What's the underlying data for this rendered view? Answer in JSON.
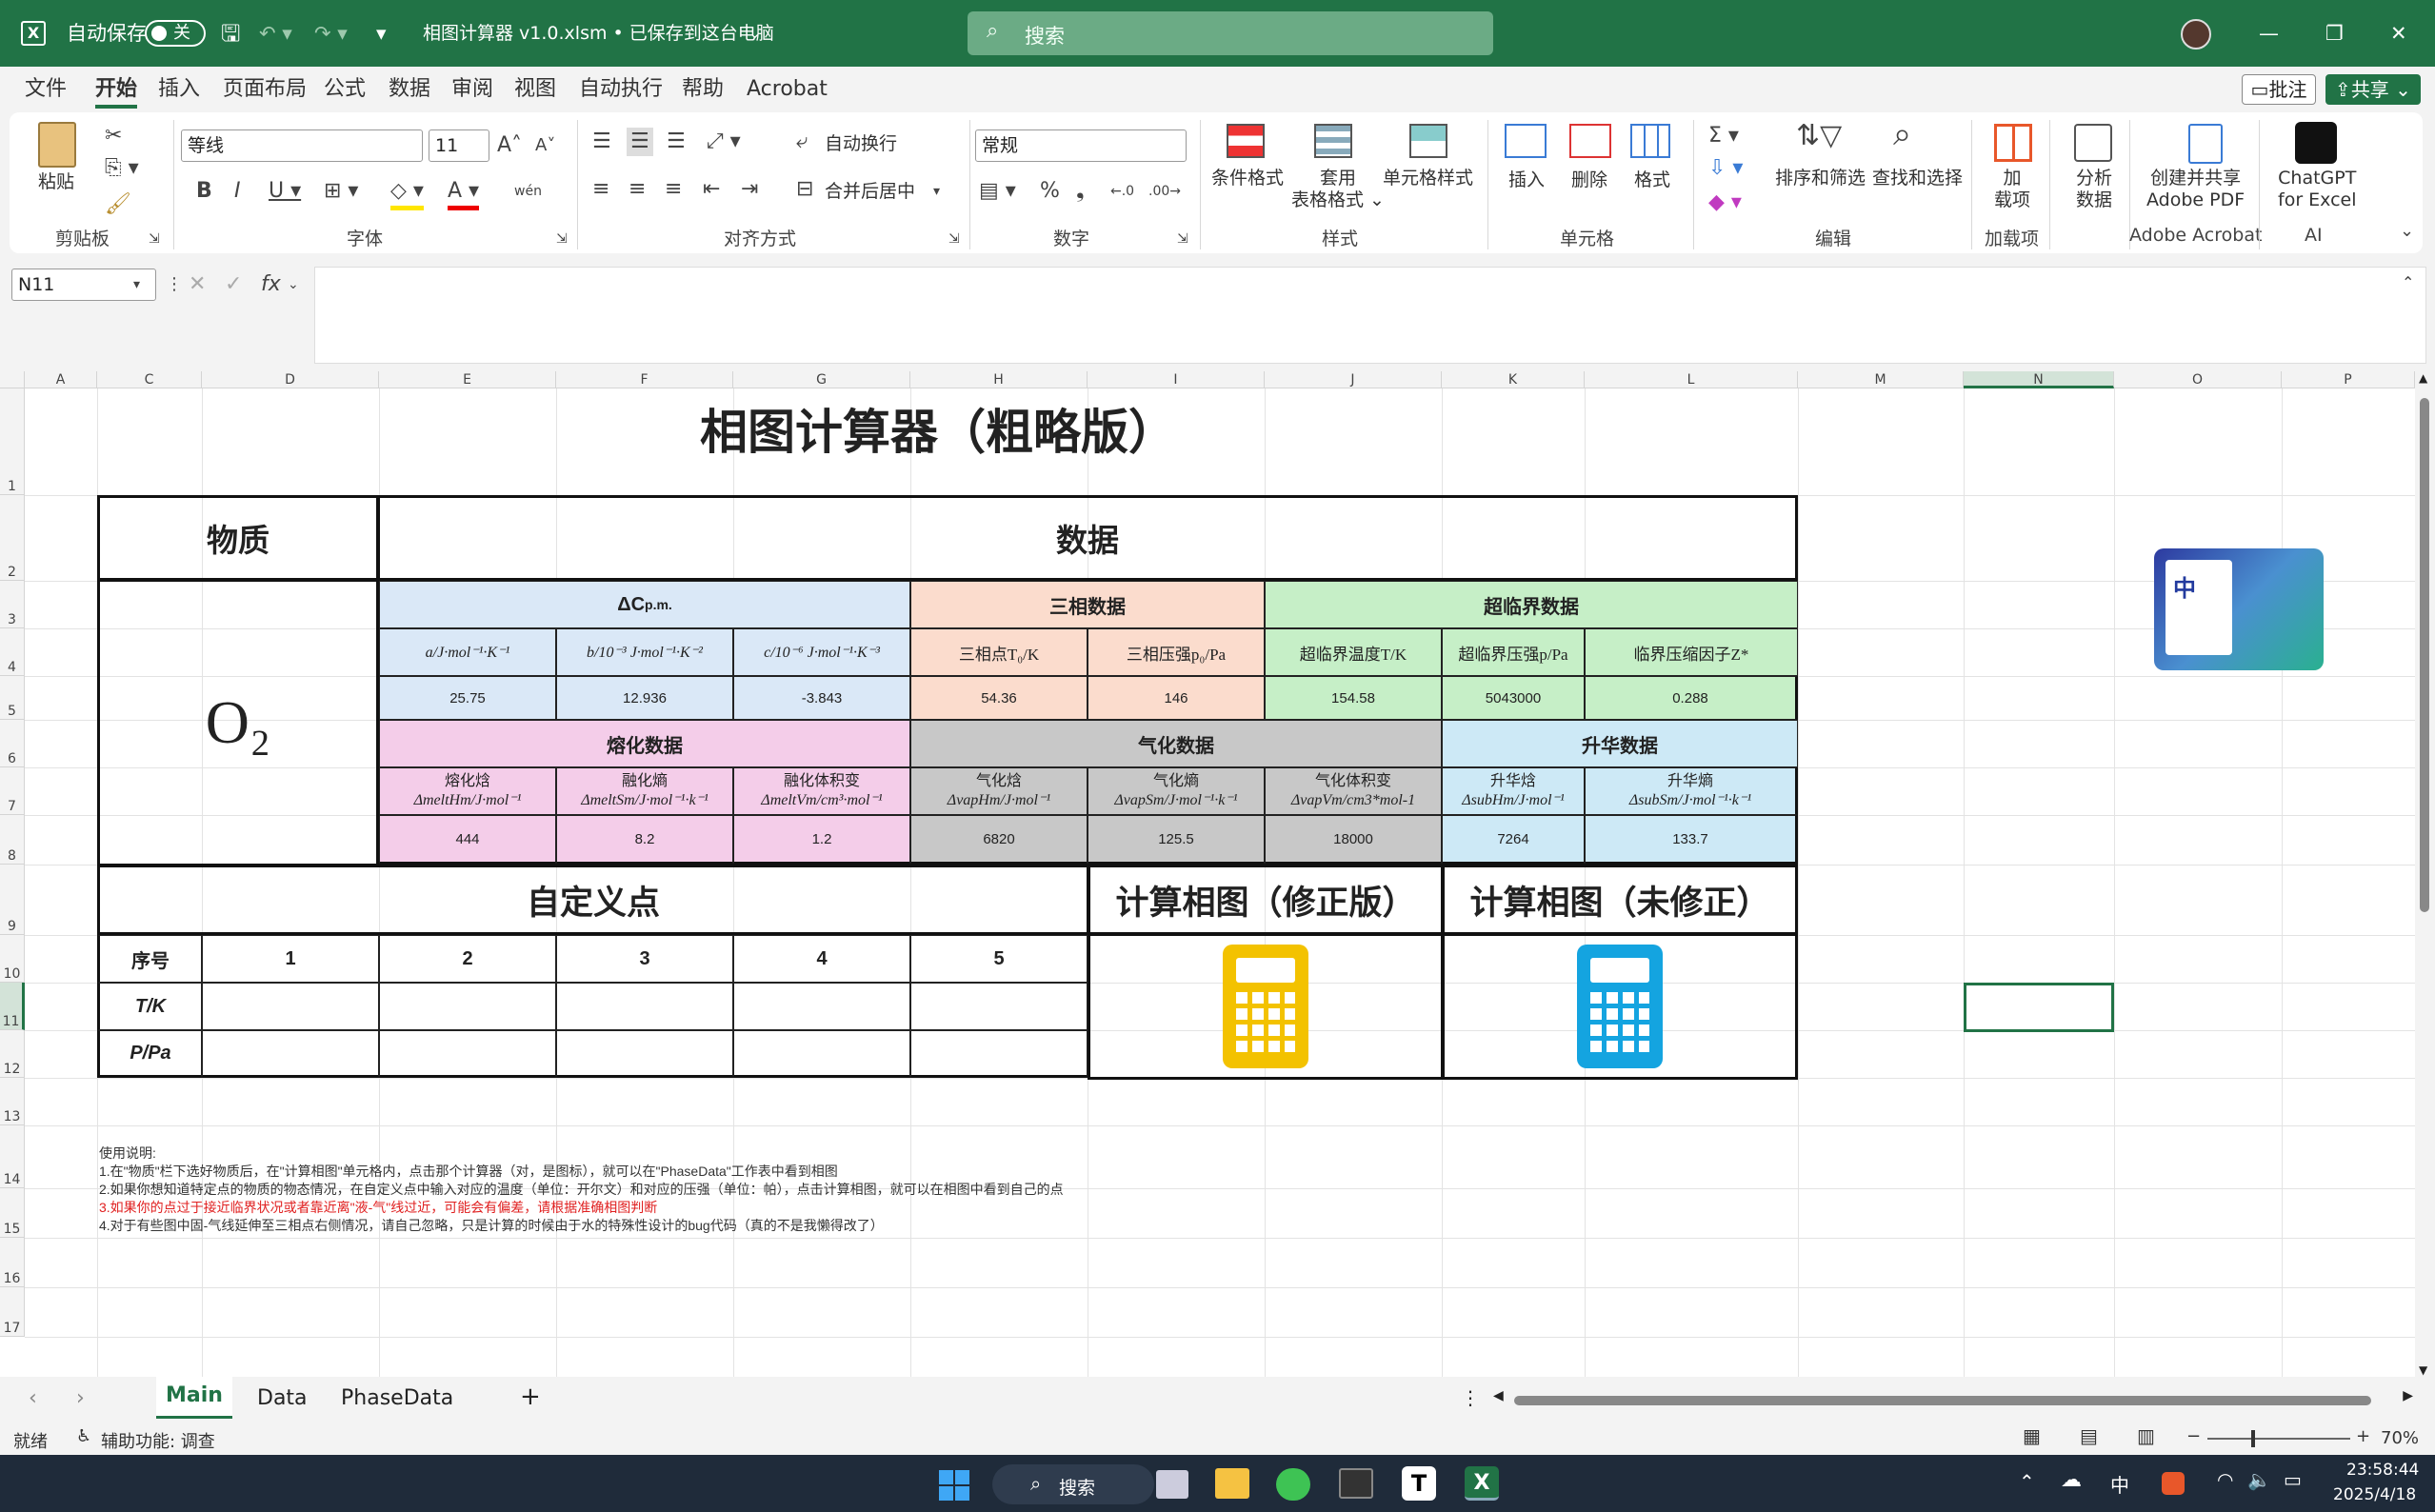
{
  "titlebar": {
    "autosave": "自动保存",
    "toggle": "关",
    "filename": "相图计算器 v1.0.xlsm • 已保存到这台电脑",
    "search_placeholder": "搜索"
  },
  "tabs": [
    "文件",
    "开始",
    "插入",
    "页面布局",
    "公式",
    "数据",
    "审阅",
    "视图",
    "自动执行",
    "帮助",
    "Acrobat"
  ],
  "tab_right": {
    "comments": "批注",
    "share": "共享"
  },
  "ribbon": {
    "paste": "粘贴",
    "clipboard": "剪贴板",
    "font": "字体",
    "font_name": "等线",
    "font_size": "11",
    "wen": "wén",
    "wrap": "自动换行",
    "merge": "合并后居中",
    "alignment": "对齐方式",
    "number_format": "常规",
    "number": "数字",
    "cond_format": "条件格式",
    "table_format_1": "套用",
    "table_format_2": "表格格式",
    "cell_style": "单元格样式",
    "styles": "样式",
    "insert": "插入",
    "delete": "删除",
    "format": "格式",
    "cells": "单元格",
    "sort": "排序和筛选",
    "find": "查找和选择",
    "editing": "编辑",
    "addins_1": "加",
    "addins_2": "载项",
    "addins": "加载项",
    "analyze_1": "分析",
    "analyze_2": "数据",
    "acrobat_1": "创建并共享",
    "acrobat_2": "Adobe PDF",
    "acrobat": "Adobe Acrobat",
    "gpt_1": "ChatGPT",
    "gpt_2": "for Excel",
    "ai": "AI"
  },
  "formula": {
    "namebox": "N11",
    "fx": "fx"
  },
  "columns": [
    "A",
    "C",
    "D",
    "E",
    "F",
    "G",
    "H",
    "I",
    "J",
    "K",
    "L",
    "M",
    "N",
    "O",
    "P"
  ],
  "rows": [
    "1",
    "2",
    "3",
    "4",
    "5",
    "6",
    "7",
    "8",
    "9",
    "10",
    "11",
    "12",
    "13",
    "14",
    "15",
    "16",
    "17"
  ],
  "sheet": {
    "title": "相图计算器（粗略版）",
    "substance_header": "物质",
    "data_header": "数据",
    "substance": "O₂",
    "dcp": "ΔC",
    "dcp_sub": "p.m.",
    "triple": "三相数据",
    "supercritical": "超临界数据",
    "col_a": "a/J·mol⁻¹·K⁻¹",
    "col_b": "b/10⁻³ J·mol⁻¹·K⁻²",
    "col_c": "c/10⁻⁶ J·mol⁻¹·K⁻³",
    "col_tt": "三相点T₀/K",
    "col_pt": "三相压强p₀/Pa",
    "col_tc": "超临界温度T/K",
    "col_pc": "超临界压强p/Pa",
    "col_z": "临界压缩因子Z*",
    "row5": [
      "25.75",
      "12.936",
      "-3.843",
      "54.36",
      "146",
      "154.58",
      "5043000",
      "0.288"
    ],
    "melt": "熔化数据",
    "vap": "气化数据",
    "subl": "升华数据",
    "row7": [
      [
        "熔化焓",
        "ΔmeltHm/J·mol⁻¹"
      ],
      [
        "融化熵",
        "ΔmeltSm/J·mol⁻¹·k⁻¹"
      ],
      [
        "融化体积变",
        "ΔmeltVm/cm³·mol⁻¹"
      ],
      [
        "气化焓",
        "ΔvapHm/J·mol⁻¹"
      ],
      [
        "气化熵",
        "ΔvapSm/J·mol⁻¹·k⁻¹"
      ],
      [
        "气化体积变",
        "ΔvapVm/cm3*mol-1"
      ],
      [
        "升华焓",
        "ΔsubHm/J·mol⁻¹"
      ],
      [
        "升华熵",
        "ΔsubSm/J·mol⁻¹·k⁻¹"
      ]
    ],
    "row8": [
      "444",
      "8.2",
      "1.2",
      "6820",
      "125.5",
      "18000",
      "7264",
      "133.7"
    ],
    "custom": "自定义点",
    "calc_fixed": "计算相图（修正版）",
    "calc_raw": "计算相图（未修正）",
    "seq": "序号",
    "nums": [
      "1",
      "2",
      "3",
      "4",
      "5"
    ],
    "tk": "T/K",
    "ppa": "P/Pa",
    "notes": [
      "使用说明:",
      "1.在\"物质\"栏下选好物质后，在\"计算相图\"单元格内，点击那个计算器（对，是图标），就可以在\"PhaseData\"工作表中看到相图",
      "2.如果你想知道特定点的物质的物态情况，在自定义点中输入对应的温度（单位：开尔文）和对应的压强（单位：帕），点击计算相图，就可以在相图中看到自己的点",
      "3.如果你的点过于接近临界状况或者靠近离\"液-气\"线过近，可能会有偏差，请根据准确相图判断",
      "4.对于有些图中固-气线延伸至三相点右侧情况，请自己忽略，只是计算的时候由于水的特殊性设计的bug代码（真的不是我懒得改了）"
    ],
    "logo_text": "中"
  },
  "sheets": [
    "Main",
    "Data",
    "PhaseData"
  ],
  "status": {
    "ready": "就绪",
    "accessibility": "辅助功能: 调查",
    "zoom": "70%"
  },
  "taskbar": {
    "search": "搜索",
    "ime": "中",
    "time": "23:58:44",
    "date": "2025/4/18"
  },
  "colors": {
    "excel_green": "#217346",
    "blue": "#dae8f7",
    "peach": "#fbdccd",
    "green": "#c6efc7",
    "pink": "#f4cde9",
    "gray": "#c8c8c8",
    "lightblue": "#cde9f6",
    "calc_yellow": "#f3c200",
    "calc_blue": "#14a4e0",
    "note_red": "#e02020"
  }
}
